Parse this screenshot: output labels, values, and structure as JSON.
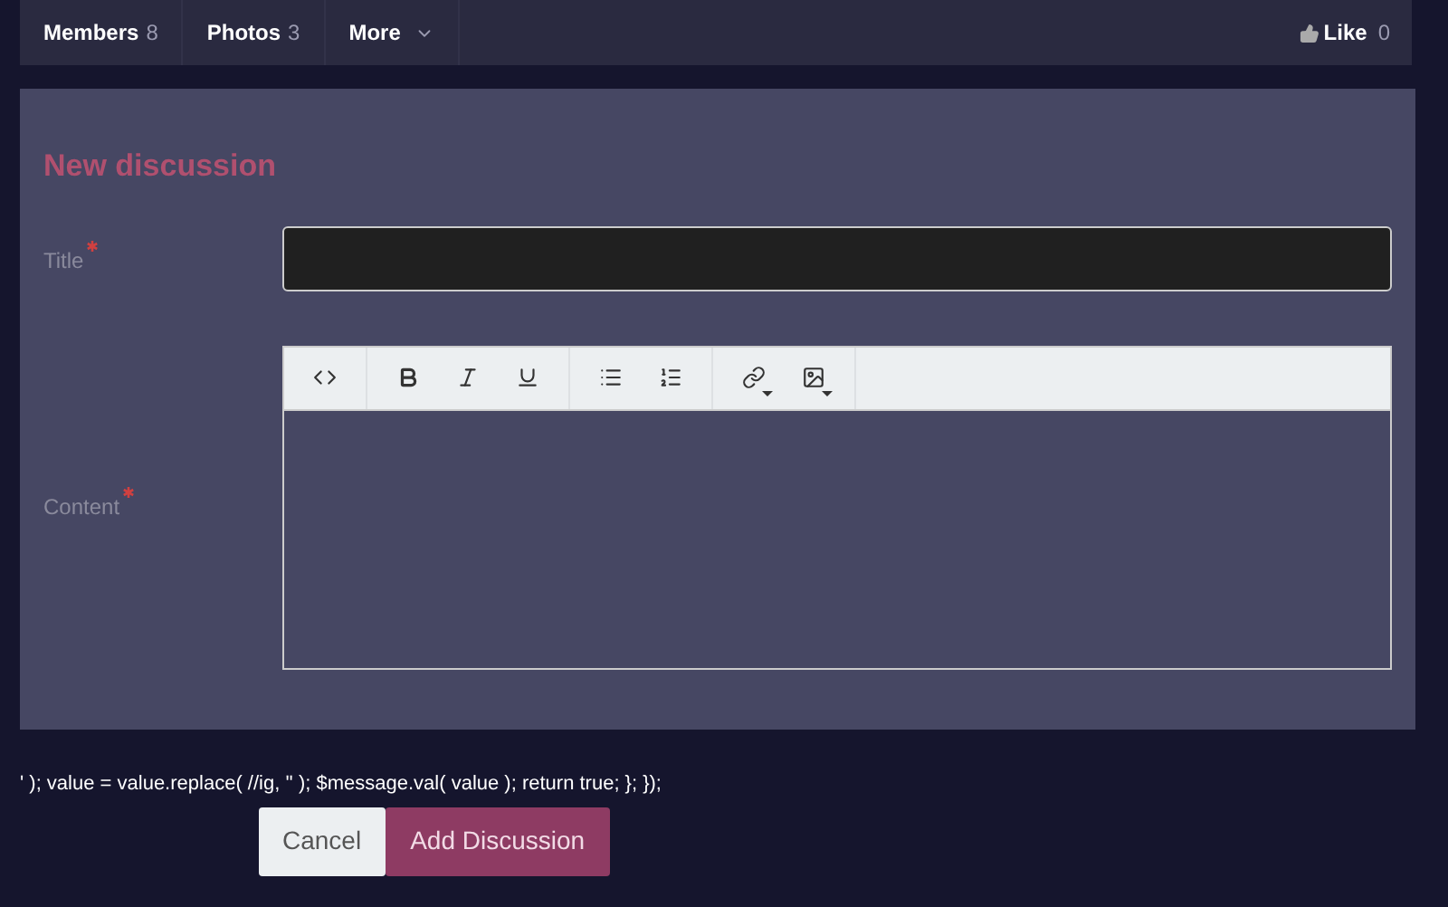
{
  "nav": {
    "tabs": [
      {
        "label": "Members",
        "count": "8",
        "kind": "count"
      },
      {
        "label": "Photos",
        "count": "3",
        "kind": "count"
      },
      {
        "label": "More",
        "kind": "dropdown"
      }
    ],
    "like": {
      "label": "Like",
      "count": "0"
    }
  },
  "form": {
    "heading": "New discussion",
    "title_field": {
      "label": "Title",
      "required": true
    },
    "content_field": {
      "label": "Content",
      "required": true
    },
    "toolbar": [
      [
        {
          "kind": "code"
        }
      ],
      [
        {
          "kind": "bold"
        },
        {
          "kind": "italic"
        },
        {
          "kind": "underline"
        }
      ],
      [
        {
          "kind": "bullet-list"
        },
        {
          "kind": "numbered-list"
        }
      ],
      [
        {
          "kind": "link",
          "dropdown": true
        },
        {
          "kind": "image",
          "dropdown": true
        }
      ]
    ]
  },
  "script_text": "' ); value = value.replace( //ig, '' ); $message.val( value ); return true; }; });",
  "buttons": [
    {
      "label": "Cancel",
      "kind": "secondary"
    },
    {
      "label": "Add Discussion",
      "kind": "primary"
    }
  ]
}
